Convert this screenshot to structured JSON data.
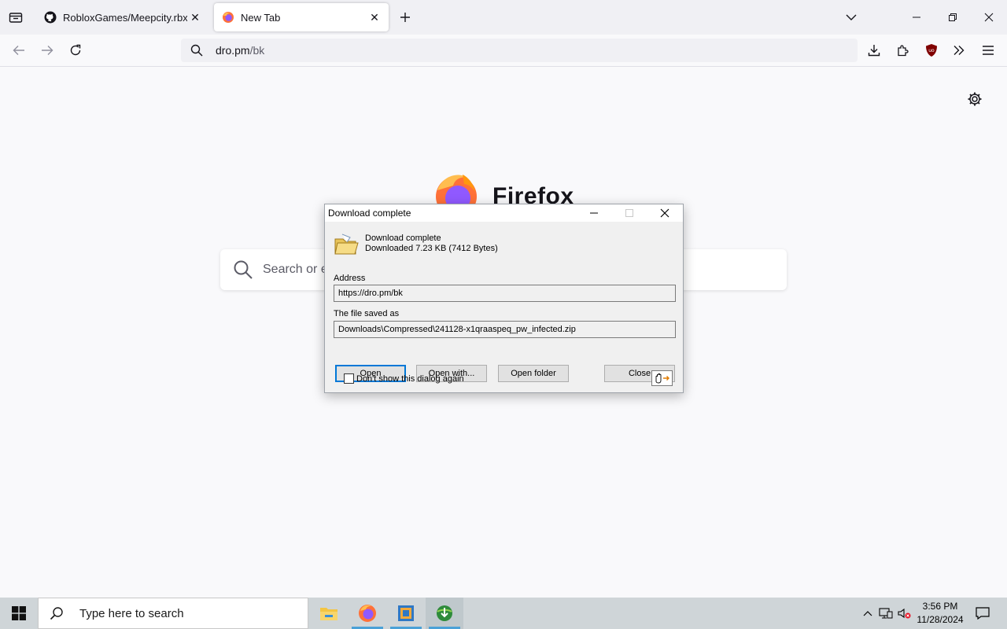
{
  "browser": {
    "tabs": [
      {
        "title": "RobloxGames/Meepcity.rbxl at",
        "icon": "github-icon",
        "active": false
      },
      {
        "title": "New Tab",
        "icon": "firefox-icon",
        "active": true
      }
    ],
    "url_host": "dro.pm",
    "url_path": "/bk"
  },
  "newtab": {
    "wordmark": "Firefox",
    "search_placeholder": "Search or en"
  },
  "dialog": {
    "title": "Download complete",
    "heading": "Download complete",
    "subheading": "Downloaded 7.23  KB (7412 Bytes)",
    "address_label": "Address",
    "address_value": "https://dro.pm/bk",
    "saved_label": "The file saved as",
    "saved_value": "Downloads\\Compressed\\241128-x1qraaspeq_pw_infected.zip",
    "buttons": {
      "open": "Open",
      "open_with": "Open with...",
      "open_folder": "Open folder",
      "close": "Close"
    },
    "checkbox_label": "Don't show this dialog again",
    "checkbox_checked": false
  },
  "taskbar": {
    "search_placeholder": "Type here to search",
    "time": "3:56 PM",
    "date": "11/28/2024",
    "apps": [
      "file-explorer-icon",
      "firefox-icon",
      "virtualbox-icon",
      "download-manager-icon"
    ]
  },
  "colors": {
    "accent": "#0078d7",
    "ublock": "#800000"
  }
}
